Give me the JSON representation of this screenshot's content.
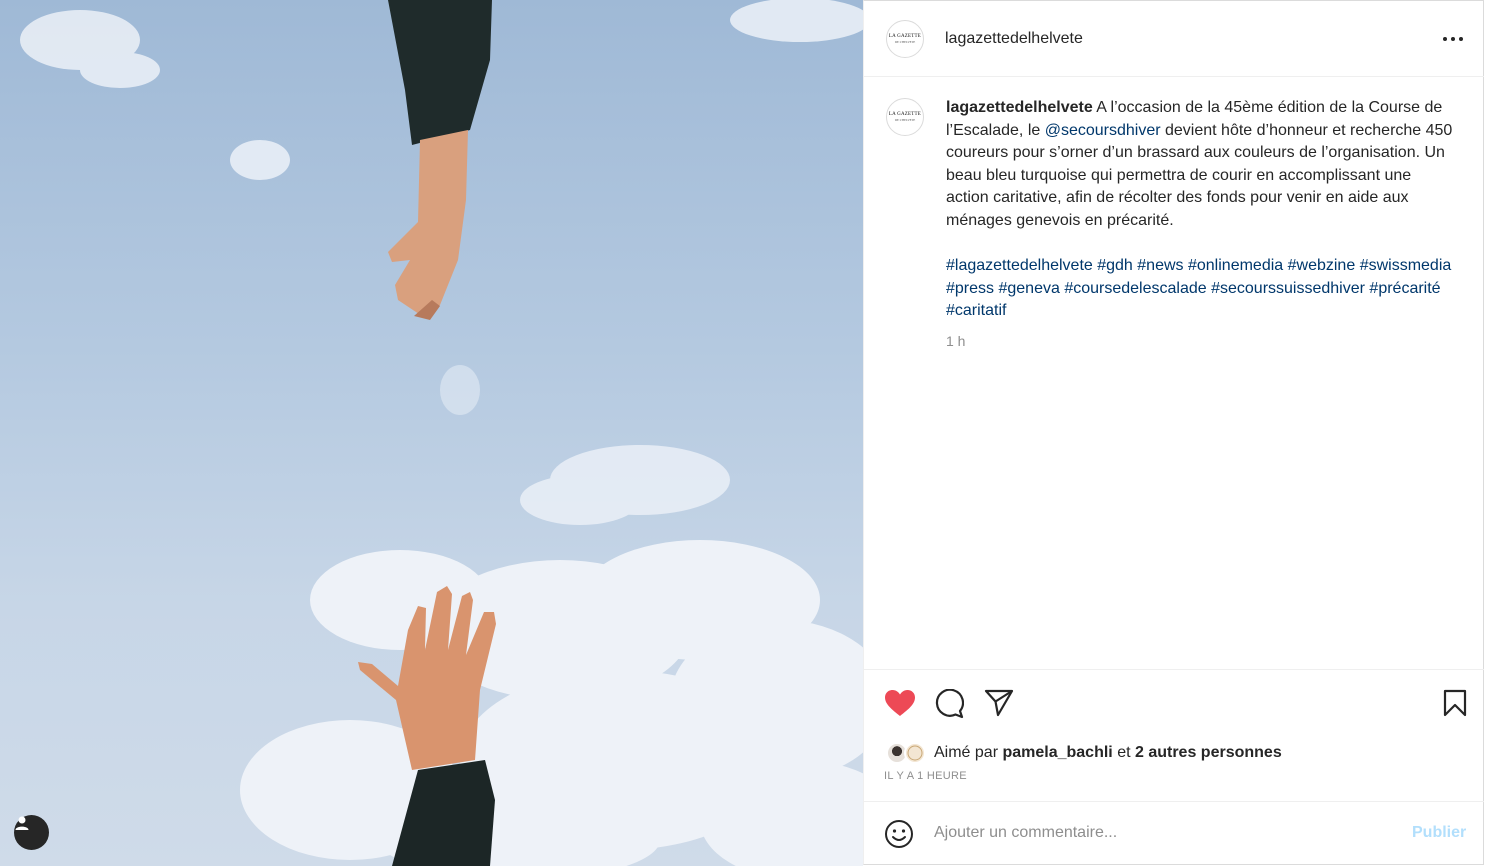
{
  "post": {
    "username": "lagazettedelhelvete",
    "avatar_text_line1": "LA GAZETTE",
    "avatar_text_line2": "DE L'HELVETE",
    "more_icon": "more-horizontal-icon",
    "caption": {
      "username": "lagazettedelhelvete",
      "text_part1": "A l’occasion de la 45ème édition de la Course de l’Escalade, le ",
      "mention": "@secoursdhiver",
      "text_part2": " devient hôte d’honneur et recherche 450 coureurs pour s’orner d’un brassard aux couleurs de l’organisation. Un beau bleu turquoise qui permettra de courir en accomplissant une action caritative, afin de récolter des fonds pour venir en aide aux ménages genevois en précarité.",
      "hashtags": [
        "#lagazettedelhelvete",
        "#gdh",
        "#news",
        "#onlinemedia",
        "#webzine",
        "#swissmedia",
        "#press",
        "#geneva",
        "#coursedelescalade",
        "#secourssuissedhiver",
        "#précarité",
        "#caritatif"
      ],
      "time": "1 h"
    },
    "actions": {
      "like_icon": "heart-filled-icon",
      "comment_icon": "comment-icon",
      "share_icon": "send-icon",
      "save_icon": "bookmark-icon",
      "like_color": "#ed4956"
    },
    "likes": {
      "prefix": "Aimé par ",
      "user": "pamela_bachli",
      "middle": " et ",
      "others": "2 autres personnes"
    },
    "timestamp": "IL Y A 1 HEURE",
    "comment": {
      "placeholder": "Ajouter un commentaire...",
      "emoji_icon": "emoji-smile-icon",
      "publish_label": "Publier",
      "publish_color": "#b2dffc"
    },
    "photo": {
      "description_icon": "user-tag-icon"
    }
  }
}
